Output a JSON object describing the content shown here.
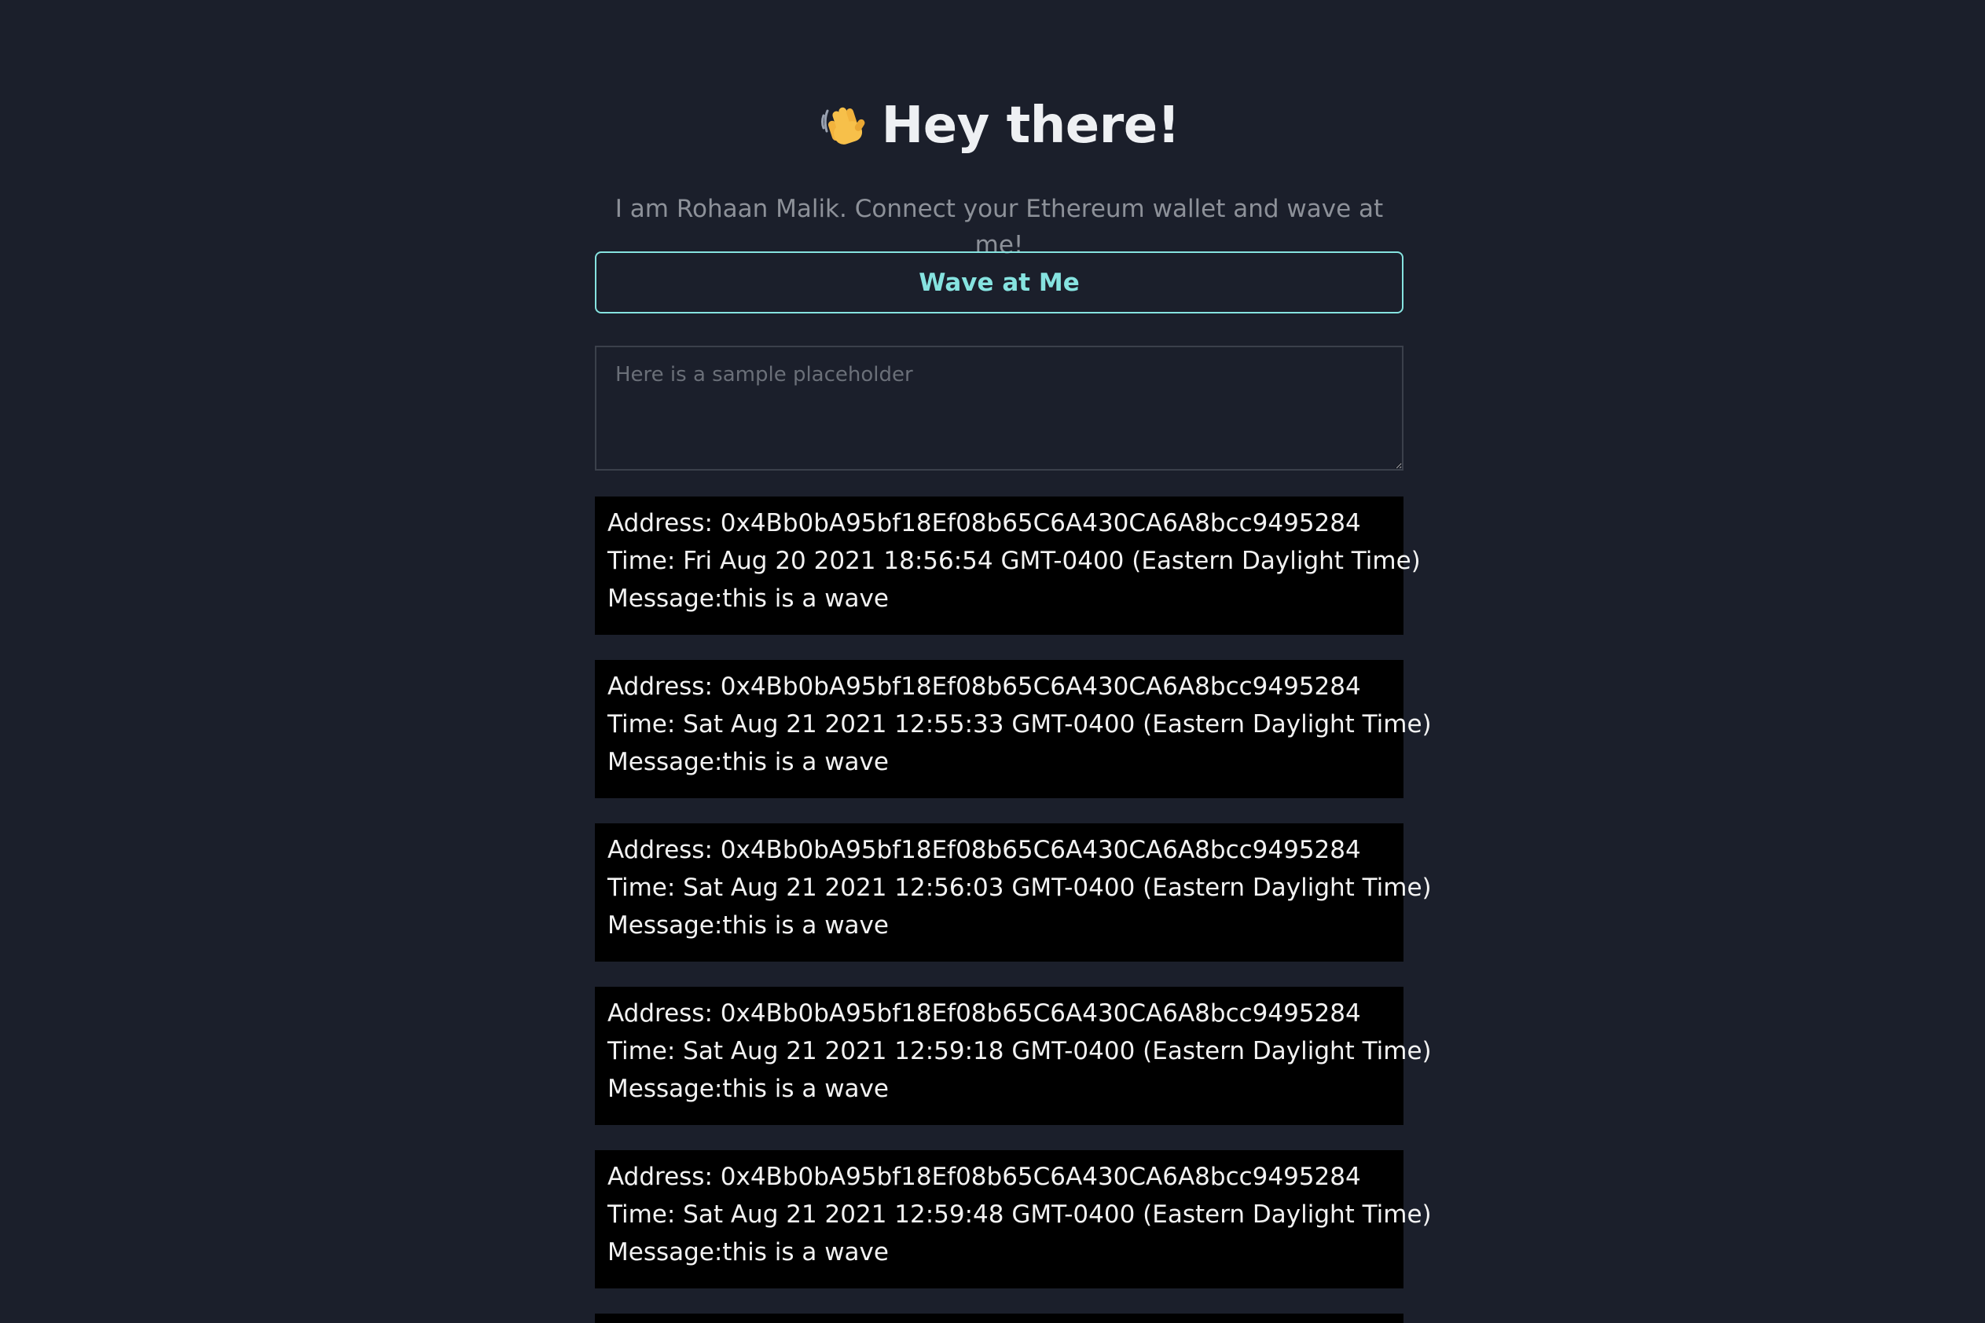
{
  "header": {
    "emoji": "👋",
    "title": "Hey there!"
  },
  "bio": "I am Rohaan Malik. Connect your Ethereum wallet and wave at me!",
  "wave_button": {
    "label": "Wave at Me"
  },
  "message_input": {
    "placeholder": "Here is a sample placeholder",
    "value": ""
  },
  "waves": [
    {
      "address_line": "Address: 0x4Bb0bA95bf18Ef08b65C6A430CA6A8bcc9495284",
      "time_line": "Time: Fri Aug 20 2021 18:56:54 GMT-0400 (Eastern Daylight Time)",
      "message_line": "Message:this is a wave"
    },
    {
      "address_line": "Address: 0x4Bb0bA95bf18Ef08b65C6A430CA6A8bcc9495284",
      "time_line": "Time: Sat Aug 21 2021 12:55:33 GMT-0400 (Eastern Daylight Time)",
      "message_line": "Message:this is a wave"
    },
    {
      "address_line": "Address: 0x4Bb0bA95bf18Ef08b65C6A430CA6A8bcc9495284",
      "time_line": "Time: Sat Aug 21 2021 12:56:03 GMT-0400 (Eastern Daylight Time)",
      "message_line": "Message:this is a wave"
    },
    {
      "address_line": "Address: 0x4Bb0bA95bf18Ef08b65C6A430CA6A8bcc9495284",
      "time_line": "Time: Sat Aug 21 2021 12:59:18 GMT-0400 (Eastern Daylight Time)",
      "message_line": "Message:this is a wave"
    },
    {
      "address_line": "Address: 0x4Bb0bA95bf18Ef08b65C6A430CA6A8bcc9495284",
      "time_line": "Time: Sat Aug 21 2021 12:59:48 GMT-0400 (Eastern Daylight Time)",
      "message_line": "Message:this is a wave"
    }
  ],
  "colors": {
    "background": "#1b1f2b",
    "accent": "#86e3e0",
    "card_background": "#000000",
    "title_text": "#eef0f3",
    "muted_text": "#8d9199"
  },
  "icons": {
    "header_emoji": "waving-hand-icon"
  }
}
